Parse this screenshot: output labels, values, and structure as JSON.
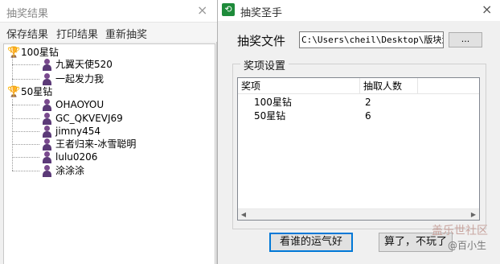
{
  "left_window": {
    "title": "抽奖结果",
    "close_glyph": "×",
    "menu": [
      "保存结果",
      "打印结果",
      "重新抽奖"
    ],
    "tree": [
      {
        "label": "100星钻",
        "winners": [
          "九翼天使520",
          "一起发力我"
        ]
      },
      {
        "label": "50星钻",
        "winners": [
          "OHAOYOU",
          "GC_QKVEVJ69",
          "jimny454",
          "王者归来-冰雪聪明",
          "lulu0206",
          "涂涂涂"
        ]
      }
    ]
  },
  "right_window": {
    "title": "抽奖圣手",
    "icon_glyph": "⟲",
    "close_glyph": "×",
    "file_label": "抽奖文件",
    "file_path": "C:\\Users\\cheil\\Desktop\\版块活",
    "browse_label": "...",
    "group_title": "奖项设置",
    "columns": [
      "奖项",
      "抽取人数"
    ],
    "prizes": [
      {
        "name": "100星钻",
        "count": "2"
      },
      {
        "name": "50星钻",
        "count": "6"
      }
    ],
    "scroll_left_glyph": "◀",
    "scroll_right_glyph": "▶",
    "draw_button": "看谁的运气好",
    "quit_button": "算了，不玩了"
  },
  "watermark": {
    "line1": "盖乐世社区",
    "line2": "@百小生"
  },
  "icons": {
    "trophy": "trophy-icon",
    "person": "person-icon"
  },
  "colors": {
    "trophy": "#c99a00",
    "person": "#5c3a78",
    "app_icon": "#1e8b3a",
    "default_button_border": "#0078d7"
  }
}
